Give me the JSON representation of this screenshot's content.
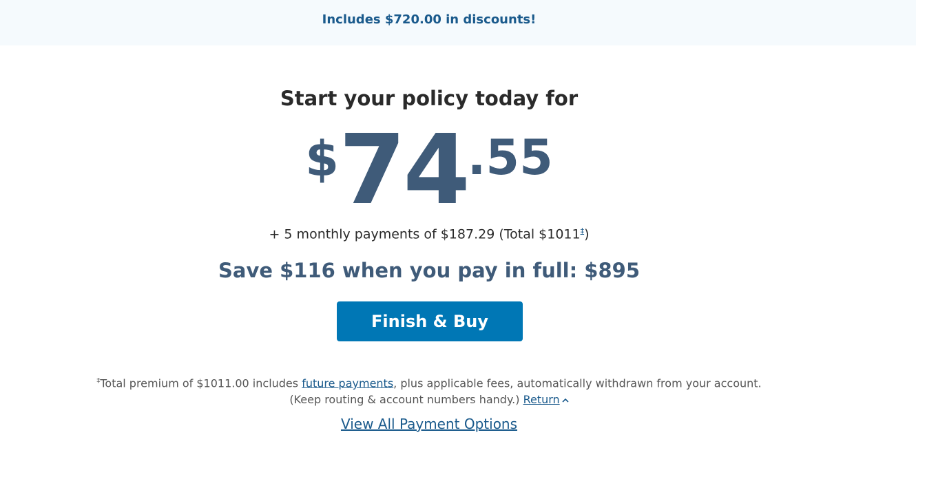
{
  "banner": {
    "text": "Includes $720.00 in discounts!"
  },
  "headline": "Start your policy today for",
  "price": {
    "currency": "$",
    "dollars": "74",
    "cents": ".55"
  },
  "monthly": {
    "text": "+ 5 monthly payments of $187.29 (Total $1011",
    "marker": "‡",
    "close": ")"
  },
  "save": "Save $116 when you pay in full: $895",
  "buy_button": "Finish & Buy",
  "footnote": {
    "marker": "‡",
    "text_before": "Total premium of $1011.00 includes ",
    "link": "future payments",
    "text_after": ", plus applicable fees, automatically withdrawn from your account.",
    "line2": "(Keep routing & account numbers handy.) ",
    "return_link": "Return"
  },
  "view_all": "View All Payment Options",
  "colors": {
    "accent": "#0077b5",
    "price": "#3f5b79",
    "link": "#1a5a8c"
  },
  "icons": {
    "return": "chevron-up-icon"
  }
}
